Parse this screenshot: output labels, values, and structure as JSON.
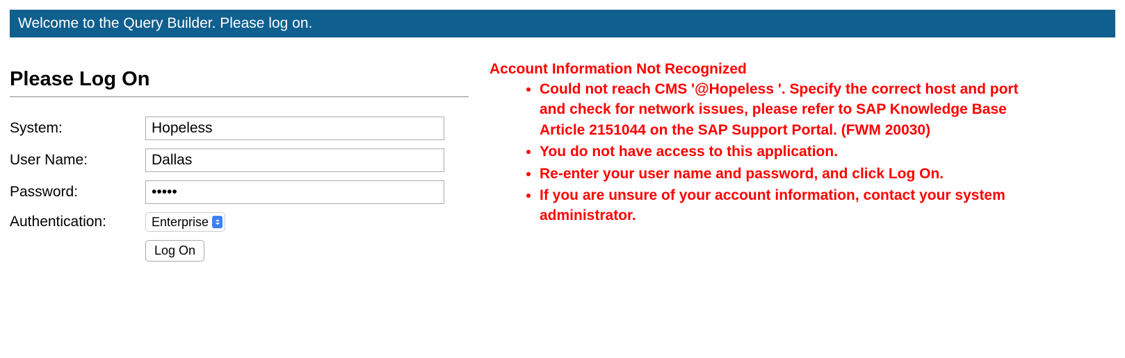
{
  "banner": {
    "text": "Welcome to the Query Builder. Please log on."
  },
  "form": {
    "heading": "Please Log On",
    "labels": {
      "system": "System:",
      "username": "User Name:",
      "password": "Password:",
      "authentication": "Authentication:"
    },
    "values": {
      "system": "Hopeless",
      "username": "Dallas",
      "password": "•••••",
      "authentication": "Enterprise"
    },
    "button": "Log On"
  },
  "error": {
    "title": "Account Information Not Recognized",
    "items": [
      "Could not reach CMS '@Hopeless                                      '. Specify the correct host and port and check for network issues, please refer to SAP Knowledge Base Article 2151044 on the SAP Support Portal. (FWM 20030)",
      "You do not have access to this application.",
      "Re-enter your user name and password, and click Log On.",
      "If you are unsure of your account information, contact your system administrator."
    ]
  }
}
